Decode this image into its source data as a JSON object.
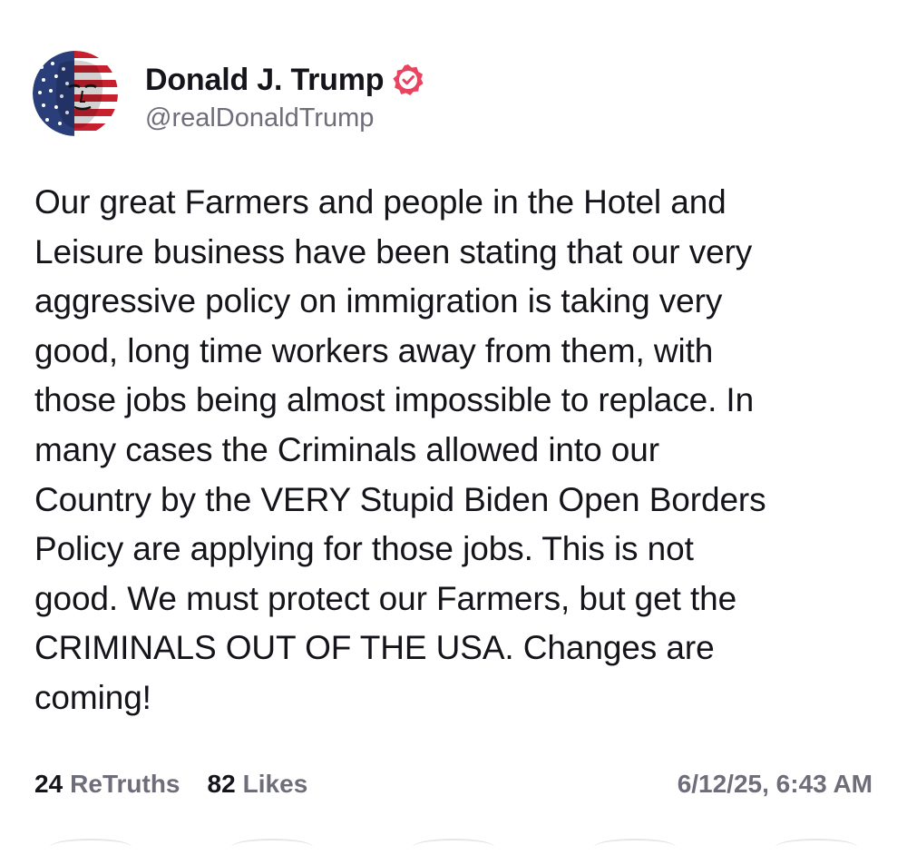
{
  "post": {
    "author": {
      "display_name": "Donald J. Trump",
      "handle": "@realDonaldTrump",
      "verified": true,
      "avatar_icon": "flag-portrait-avatar",
      "verified_icon": "verified-badge-icon"
    },
    "text": "Our great Farmers and people in the Hotel and\nLeisure business have been stating that our very\naggressive policy on immigration is taking very\ngood, long time workers away from them, with\nthose jobs being almost impossible to replace. In\nmany cases the Criminals allowed into our\nCountry by the VERY Stupid Biden Open Borders\nPolicy are applying for those jobs. This is not\ngood. We must protect our Farmers, but get the\nCRIMINALS OUT OF THE USA. Changes are\ncoming!",
    "stats": {
      "retruths_count": "24",
      "retruths_label": "ReTruths",
      "likes_count": "82",
      "likes_label": "Likes"
    },
    "timestamp": "6/12/25, 6:43 AM"
  },
  "colors": {
    "text_primary": "#14141a",
    "text_secondary": "#6e6e7a",
    "verified_badge": "#e8445f",
    "background": "#ffffff"
  }
}
